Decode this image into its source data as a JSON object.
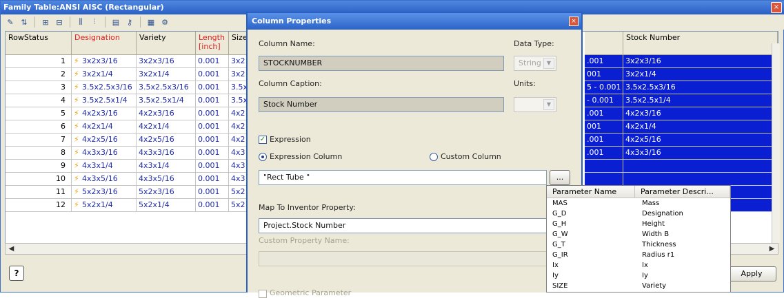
{
  "family_window": {
    "title": "Family Table:ANSI AISC (Rectangular)",
    "close_glyph": "×",
    "toolbar_icons": [
      "edit-icon",
      "sort-icon",
      "insert-row-icon",
      "delete-row-icon",
      "insert-column-icon",
      "delete-column-icon",
      "column-properties-icon",
      "key-icon",
      "export-icon",
      "settings-icon"
    ],
    "columns": {
      "rowstatus": "RowStatus",
      "designation": "Designation",
      "variety": "Variety",
      "length": "Length\n[inch]",
      "size": "Size",
      "stock_number": "Stock Number"
    },
    "rows": [
      {
        "n": "1",
        "des": "3x2x3/16",
        "var": "3x2x3/16",
        "len": "0.001",
        "size": "3x2",
        "right": ".001",
        "stock": "3x2x3/16"
      },
      {
        "n": "2",
        "des": "3x2x1/4",
        "var": "3x2x1/4",
        "len": "0.001",
        "size": "3x2",
        "right": "001",
        "stock": "3x2x1/4"
      },
      {
        "n": "3",
        "des": "3.5x2.5x3/16",
        "var": "3.5x2.5x3/16",
        "len": "0.001",
        "size": "3.5x",
        "right": "5 - 0.001",
        "stock": "3.5x2.5x3/16"
      },
      {
        "n": "4",
        "des": "3.5x2.5x1/4",
        "var": "3.5x2.5x1/4",
        "len": "0.001",
        "size": "3.5x",
        "right": "- 0.001",
        "stock": "3.5x2.5x1/4"
      },
      {
        "n": "5",
        "des": "4x2x3/16",
        "var": "4x2x3/16",
        "len": "0.001",
        "size": "4x2",
        "right": ".001",
        "stock": "4x2x3/16"
      },
      {
        "n": "6",
        "des": "4x2x1/4",
        "var": "4x2x1/4",
        "len": "0.001",
        "size": "4x2",
        "right": "001",
        "stock": "4x2x1/4"
      },
      {
        "n": "7",
        "des": "4x2x5/16",
        "var": "4x2x5/16",
        "len": "0.001",
        "size": "4x2",
        "right": ".001",
        "stock": "4x2x5/16"
      },
      {
        "n": "8",
        "des": "4x3x3/16",
        "var": "4x3x3/16",
        "len": "0.001",
        "size": "4x3",
        "right": ".001",
        "stock": "4x3x3/16"
      },
      {
        "n": "9",
        "des": "4x3x1/4",
        "var": "4x3x1/4",
        "len": "0.001",
        "size": "4x3",
        "right": "",
        "stock": ""
      },
      {
        "n": "10",
        "des": "4x3x5/16",
        "var": "4x3x5/16",
        "len": "0.001",
        "size": "4x3",
        "right": "",
        "stock": ""
      },
      {
        "n": "11",
        "des": "5x2x3/16",
        "var": "5x2x3/16",
        "len": "0.001",
        "size": "5x2",
        "right": "",
        "stock": ""
      },
      {
        "n": "12",
        "des": "5x2x1/4",
        "var": "5x2x1/4",
        "len": "0.001",
        "size": "5x2",
        "right": "",
        "stock": ""
      }
    ],
    "help_label": "?",
    "apply_label": "Apply",
    "colors": {
      "title_bar": "#2a5fc4",
      "selection": "#0a1fd1",
      "link_text": "#1e2aa8",
      "required_header": "#e21e1e"
    }
  },
  "column_properties": {
    "title": "Column Properties",
    "close_glyph": "×",
    "column_name_label": "Column Name:",
    "column_name_value": "STOCKNUMBER",
    "data_type_label": "Data Type:",
    "data_type_value": "String",
    "column_caption_label": "Column Caption:",
    "column_caption_value": "Stock Number",
    "units_label": "Units:",
    "units_value": "",
    "expression_label": "Expression",
    "expression_checked": true,
    "expression_column_label": "Expression Column",
    "custom_column_label": "Custom Column",
    "expression_value": "\"Rect Tube \"",
    "browse_label": "...",
    "map_to_label": "Map To Inventor Property:",
    "map_to_value": "Project.Stock Number",
    "custom_property_label": "Custom Property Name:",
    "custom_property_value": "",
    "geometric_parameter_label": "Geometric Parameter"
  },
  "parameter_popup": {
    "header_name": "Parameter Name",
    "header_desc": "Parameter Descri...",
    "rows": [
      {
        "name": "MAS",
        "desc": "Mass"
      },
      {
        "name": "G_D",
        "desc": "Designation"
      },
      {
        "name": "G_H",
        "desc": "Height"
      },
      {
        "name": "G_W",
        "desc": "Width B"
      },
      {
        "name": "G_T",
        "desc": "Thickness"
      },
      {
        "name": "G_IR",
        "desc": "Radius r1"
      },
      {
        "name": "Ix",
        "desc": "Ix"
      },
      {
        "name": "Iy",
        "desc": "Iy"
      },
      {
        "name": "SIZE",
        "desc": "Variety"
      }
    ]
  }
}
